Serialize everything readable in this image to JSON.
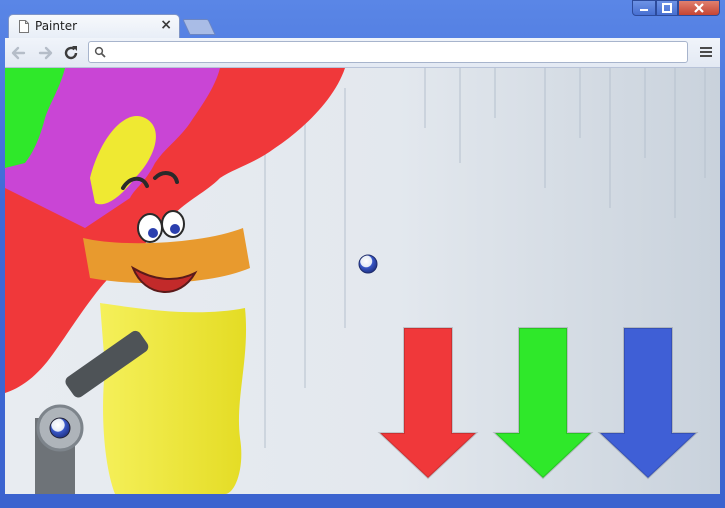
{
  "browser": {
    "tab_title": "Painter",
    "tab_close_glyph": "×",
    "address_value": "",
    "icons": {
      "page": "page-icon",
      "back": "back-arrow-icon",
      "forward": "forward-arrow-icon",
      "reload": "reload-icon",
      "search": "search-icon",
      "menu": "hamburger-menu-icon",
      "minimize": "minimize-icon",
      "maximize": "maximize-icon",
      "close": "close-icon"
    }
  },
  "game": {
    "paint_colors": {
      "red": "#f0383a",
      "green": "#2fe82a",
      "blue": "#3f5fd6",
      "purple": "#c945d5",
      "yellow": "#efe932"
    },
    "arrows": [
      {
        "color_name": "red",
        "hex": "#f0383a"
      },
      {
        "color_name": "green",
        "hex": "#2fe82a"
      },
      {
        "color_name": "blue",
        "hex": "#3f5fd6"
      }
    ],
    "character": "paintbrush-character",
    "launcher": "paint-gun-launcher",
    "ball_color": "blue"
  }
}
